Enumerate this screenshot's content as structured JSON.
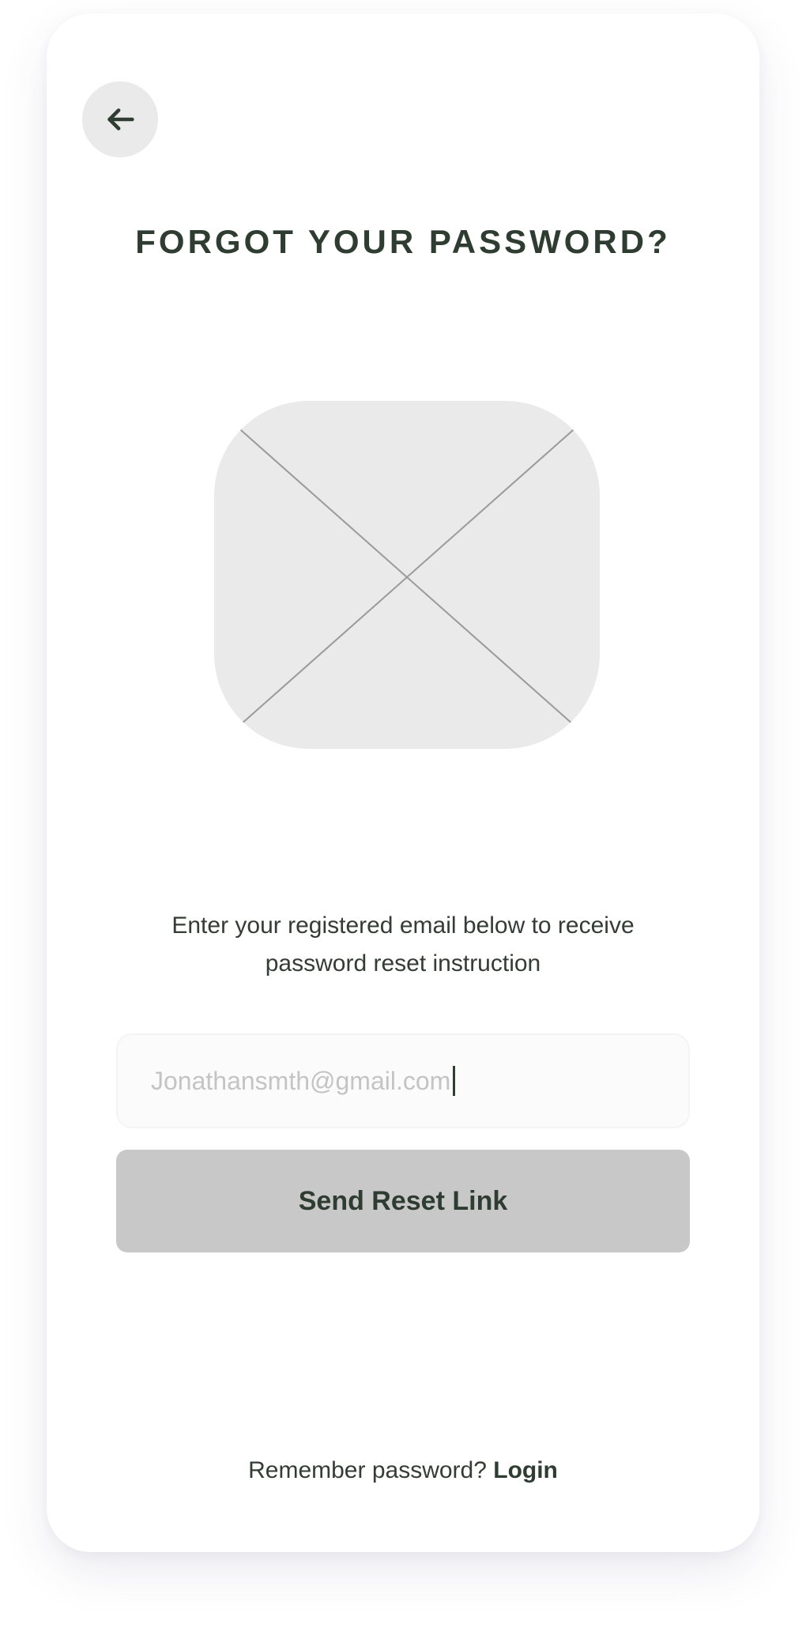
{
  "header": {
    "back_icon": "arrow-left-icon",
    "title": "FORGOT YOUR PASSWORD?"
  },
  "illustration": {
    "icon": "image-placeholder-icon"
  },
  "instructions": {
    "text": "Enter your registered email below to receive password reset instruction"
  },
  "form": {
    "email_value": "Jonathansmth@gmail.com",
    "submit_label": "Send Reset Link"
  },
  "footer": {
    "prompt": "Remember password?",
    "login_label": "Login"
  },
  "colors": {
    "primary_text": "#2f3c31",
    "muted_fill": "#e9eae9",
    "button_disabled": "#c8c8c8",
    "placeholder_text": "#c4c4c4"
  }
}
